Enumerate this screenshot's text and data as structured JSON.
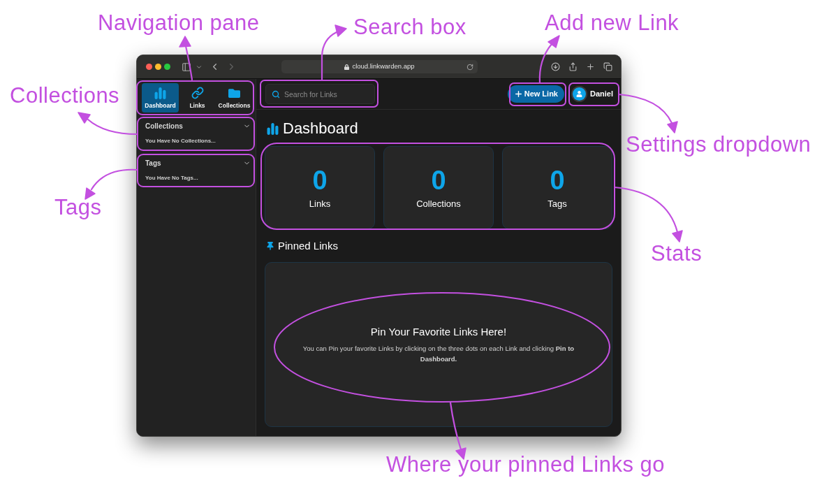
{
  "annotations": [
    "Navigation pane",
    "Search box",
    "Add new Link",
    "Collections",
    "Settings dropdown",
    "Tags",
    "Stats",
    "Where your pinned Links go"
  ],
  "browser": {
    "url": "cloud.linkwarden.app"
  },
  "sidebar": {
    "nav": [
      {
        "label": "Dashboard",
        "selected": true
      },
      {
        "label": "Links",
        "selected": false
      },
      {
        "label": "Collections",
        "selected": false
      }
    ],
    "sections": [
      {
        "title": "Collections",
        "empty_text": "You Have No Collections..."
      },
      {
        "title": "Tags",
        "empty_text": "You Have No Tags..."
      }
    ]
  },
  "topbar": {
    "search": {
      "placeholder": "Search for Links"
    },
    "new_link_button": "New Link",
    "user_name": "Daniel"
  },
  "dashboard": {
    "title": "Dashboard",
    "stats": [
      {
        "value": "0",
        "label": "Links"
      },
      {
        "value": "0",
        "label": "Collections"
      },
      {
        "value": "0",
        "label": "Tags"
      }
    ],
    "pinned": {
      "heading": "Pinned Links",
      "empty_title": "Pin Your Favorite Links Here!",
      "empty_text": "You can Pin your favorite Links by clicking on the three dots on each Link and clicking **Pin to Dashboard.**"
    }
  }
}
